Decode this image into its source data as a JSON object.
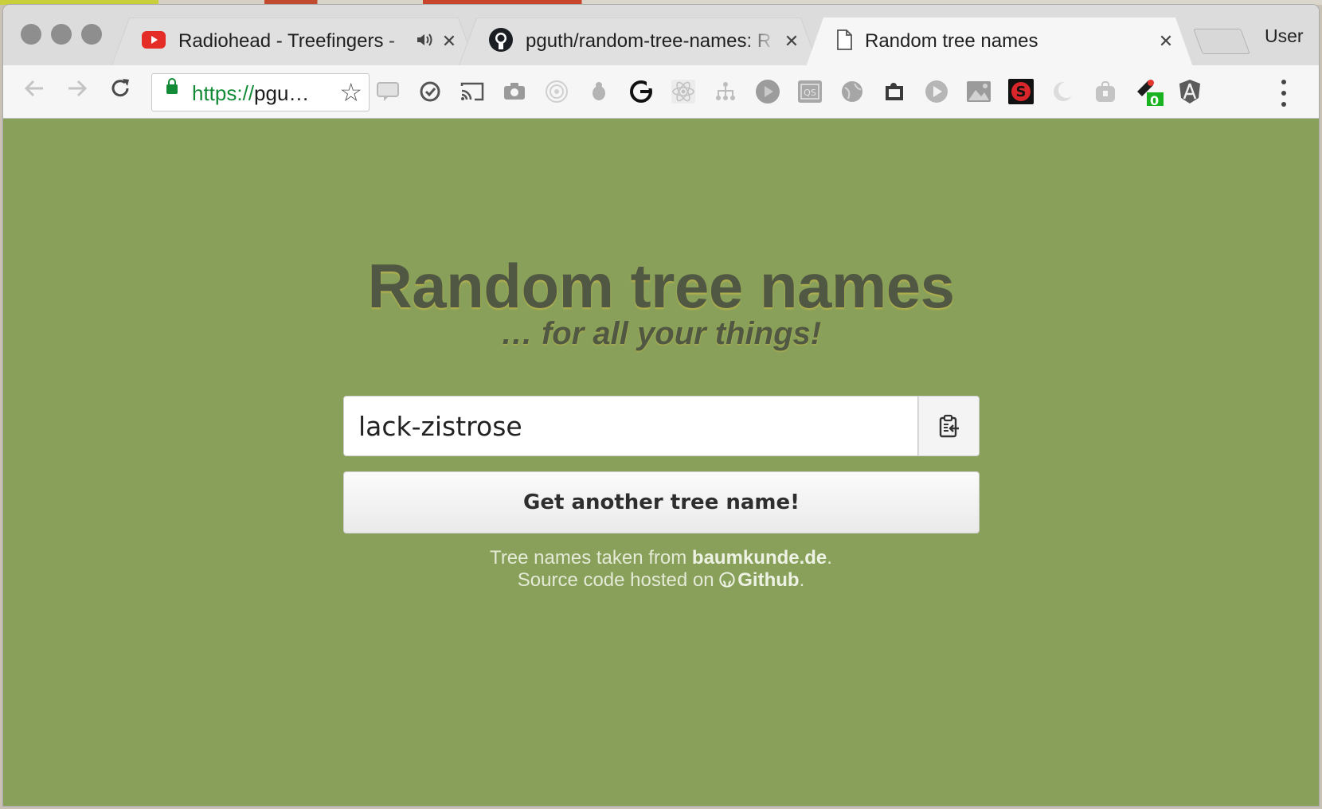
{
  "browser": {
    "tabs": [
      {
        "title": "Radiohead - Treefingers - ",
        "icon": "youtube-icon",
        "extra_icon": "speaker-icon"
      },
      {
        "title": "pguth/random-tree-names: R",
        "icon": "github-icon"
      },
      {
        "title": "Random tree names",
        "icon": "page-icon"
      }
    ],
    "close_glyph": "✕",
    "user_label": "User",
    "url_scheme": "https://",
    "url_rest": "pgu…",
    "badge_count": "0"
  },
  "page": {
    "heading": "Random tree names",
    "subheading": "… for all your things!",
    "tree_name_value": "lack-zistrose",
    "get_another_label": "Get another tree name!",
    "footer_line1_prefix": "Tree names taken from ",
    "footer_line1_link": "baumkunde.de",
    "footer_line1_suffix": ".",
    "footer_line2_prefix": "Source code hosted on ",
    "footer_line2_link": "Github",
    "footer_line2_suffix": "."
  },
  "colors": {
    "page_background": "#88a05a",
    "heading_text": "#505742",
    "url_secure": "#128a36"
  }
}
